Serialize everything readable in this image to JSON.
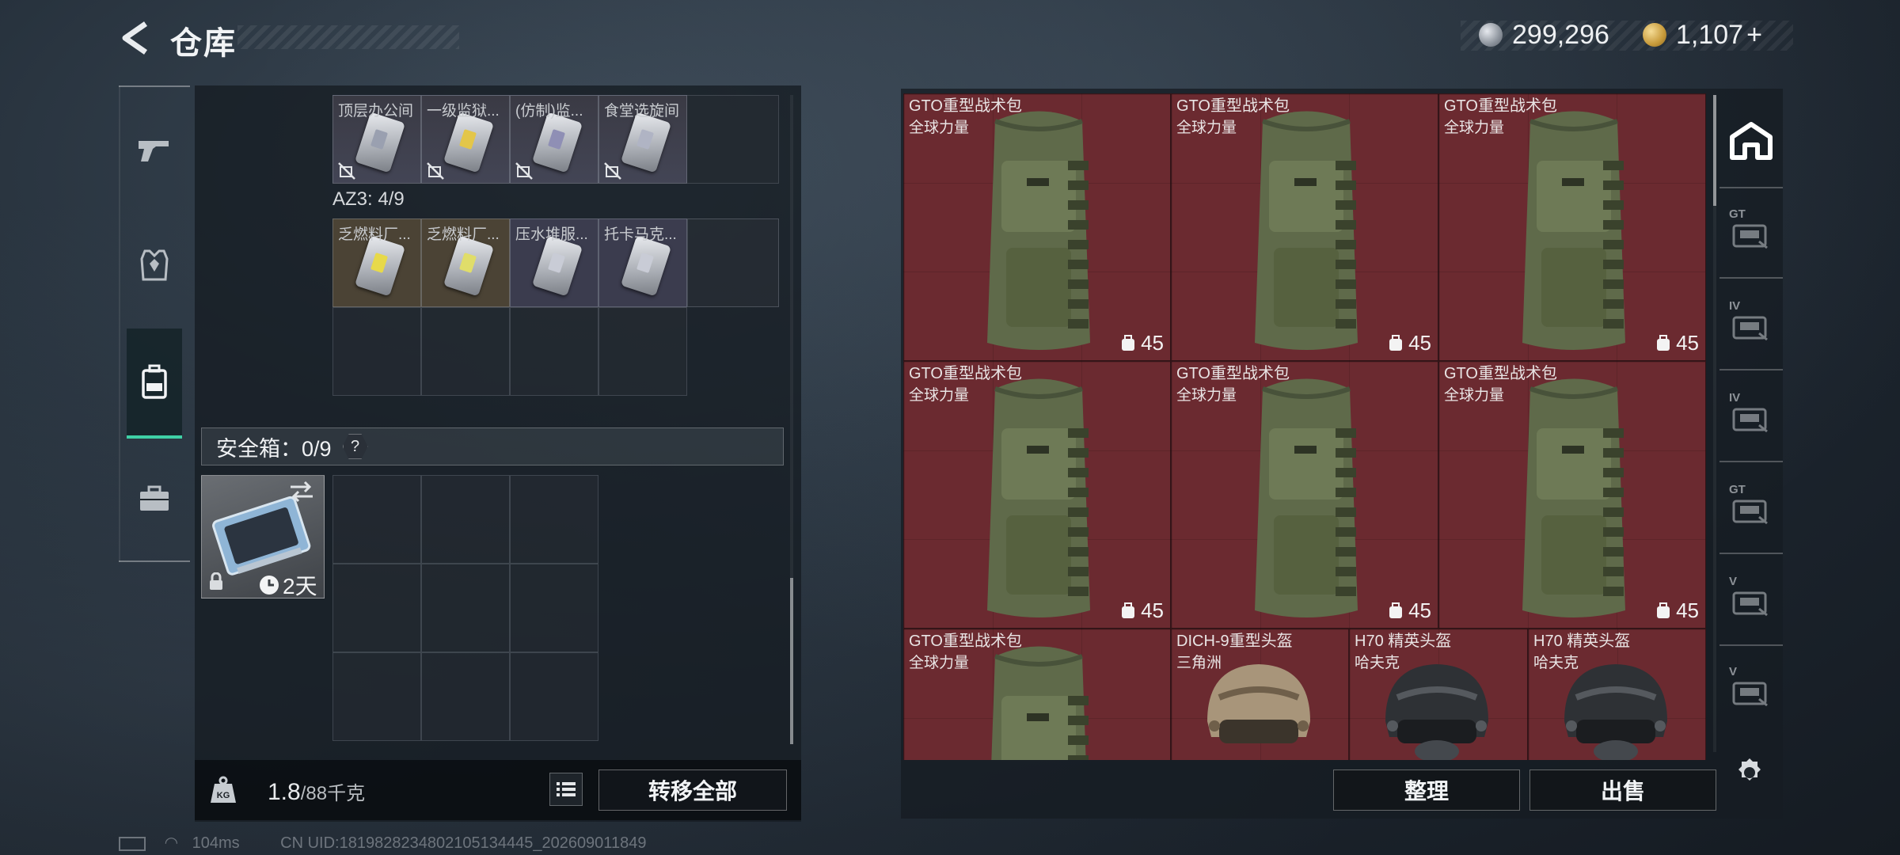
{
  "header": {
    "title": "仓库",
    "currency_a": "299,296",
    "currency_b": "1,107",
    "currency_b_suffix": "+"
  },
  "sidebar": {
    "categories": [
      {
        "icon": "gun-icon"
      },
      {
        "icon": "armor-vest-icon"
      },
      {
        "icon": "backpack-icon",
        "active": true
      },
      {
        "icon": "toolbox-icon"
      }
    ]
  },
  "container": {
    "top_items": [
      "顶层办公间",
      "一级监狱...",
      "(仿制)监...",
      "食堂选旋间"
    ],
    "az_label": "AZ3: 4/9",
    "az_items": [
      "乏燃料厂...",
      "乏燃料厂...",
      "压水堆服...",
      "托卡马克..."
    ],
    "safe_label": "安全箱：0/9",
    "safe_help": "?",
    "safe_timer": "2天"
  },
  "weight": {
    "current": "1.8",
    "max": "/88千克"
  },
  "buttons": {
    "transfer_all": "转移全部",
    "organize": "整理",
    "sell": "出售"
  },
  "storage": {
    "items": [
      {
        "name": "GTO重型战术包",
        "sub": "全球力量",
        "count": "45"
      },
      {
        "name": "GTO重型战术包",
        "sub": "全球力量",
        "count": "45"
      },
      {
        "name": "GTO重型战术包",
        "sub": "全球力量",
        "count": "45"
      },
      {
        "name": "GTO重型战术包",
        "sub": "全球力量",
        "count": "45"
      },
      {
        "name": "GTO重型战术包",
        "sub": "全球力量",
        "count": "45"
      },
      {
        "name": "GTO重型战术包",
        "sub": "全球力量",
        "count": "45"
      },
      {
        "name": "GTO重型战术包",
        "sub": "全球力量",
        "count": ""
      },
      {
        "name": "DICH-9重型头盔",
        "sub": "三角洲",
        "count": ""
      },
      {
        "name": "H70 精英头盔",
        "sub": "哈夫克",
        "count": ""
      },
      {
        "name": "H70 精英头盔",
        "sub": "哈夫克",
        "count": ""
      }
    ],
    "tabs": [
      {
        "icon": "home-storage-icon",
        "label": ""
      },
      {
        "icon": "storage-tab-gt-icon",
        "label": "GT"
      },
      {
        "icon": "storage-tab-iv-icon",
        "label": "IV"
      },
      {
        "icon": "storage-tab-iv-icon",
        "label": "IV"
      },
      {
        "icon": "storage-tab-gt-icon",
        "label": "GT"
      },
      {
        "icon": "storage-tab-v-icon",
        "label": "V"
      },
      {
        "icon": "storage-tab-v-icon",
        "label": "V"
      }
    ]
  },
  "status_bar": {
    "ping": "104ms",
    "uid": "CN UID:1819828234802105134445_202609011849"
  },
  "colors": {
    "accent": "#3fd0a6",
    "item_red": "#6b2a30"
  }
}
